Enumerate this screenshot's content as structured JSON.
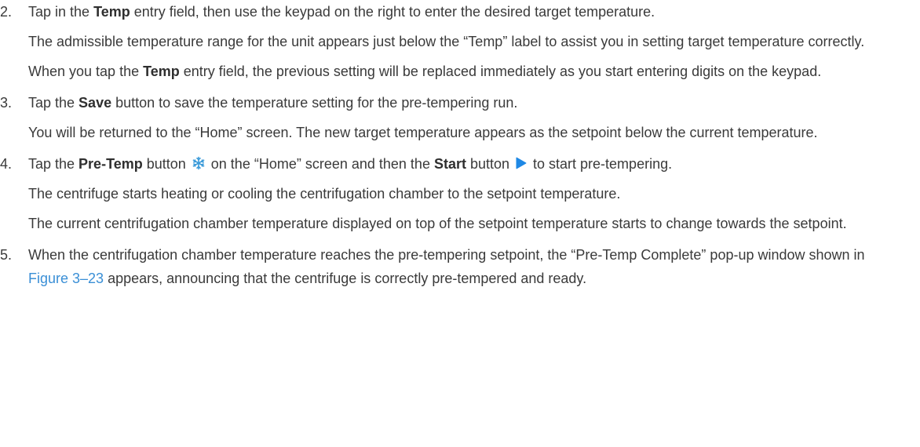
{
  "steps": [
    {
      "number": "2.",
      "paragraphs": [
        {
          "t1": "Tap in the ",
          "b1": "Temp",
          "t2": " entry field, then use the keypad on the right to enter the desired target temperature."
        },
        {
          "text": "The admissible temperature range for the unit appears just below the “Temp” label to assist you in setting target temperature correctly."
        },
        {
          "t1": "When you tap the ",
          "b1": "Temp",
          "t2": " entry field, the previous setting will be replaced immediately as you start entering digits on the keypad."
        }
      ]
    },
    {
      "number": "3.",
      "paragraphs": [
        {
          "t1": "Tap the ",
          "b1": "Save",
          "t2": " button to save the temperature setting for the pre-tempering run."
        },
        {
          "text": "You will be returned to the “Home” screen. The new target temperature appears as the setpoint below the current temperature."
        }
      ]
    },
    {
      "number": "4.",
      "paragraphs": [
        {
          "t1": "Tap the ",
          "b1": "Pre-Temp",
          "t2": " button ",
          "icon1": "snowflake-icon",
          "t3": " on the “Home” screen and then the ",
          "b2": "Start",
          "t4": " button ",
          "icon2": "play-icon",
          "t5": " to start pre-tempering."
        },
        {
          "text": "The centrifuge starts heating or cooling the centrifugation chamber to the setpoint temperature."
        },
        {
          "text": "The current centrifugation chamber temperature displayed on top of the setpoint temperature starts to change towards the setpoint."
        }
      ]
    },
    {
      "number": "5.",
      "paragraphs": [
        {
          "t1": "When the centrifugation chamber temperature reaches the pre-tempering setpoint, the “Pre-Temp Complete” pop-up window shown in ",
          "link": "Figure 3–23",
          "t2": " appears, announcing that the centrifuge is correctly pre-tempered and ready."
        }
      ]
    }
  ],
  "colors": {
    "text": "#3a3a3a",
    "link": "#3a8fd6",
    "snowflake": "#3a9ad9",
    "play": "#1e88e5"
  }
}
